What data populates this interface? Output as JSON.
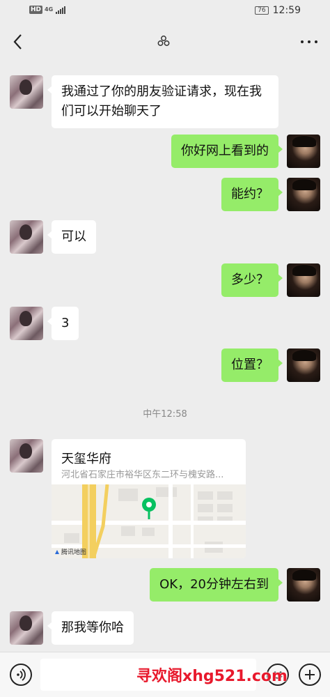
{
  "status_bar": {
    "hd_badge": "HD",
    "network": "4G",
    "battery": "76",
    "time": "12:59"
  },
  "nav": {
    "back_icon": "chevron-left-icon",
    "title_icon": "group-icon",
    "more_icon": "more-dots-icon"
  },
  "messages": [
    {
      "side": "left",
      "text": "我通过了你的朋友验证请求，现在我们可以开始聊天了"
    },
    {
      "side": "right",
      "text": "你好网上看到的"
    },
    {
      "side": "right",
      "text": "能约？"
    },
    {
      "side": "left",
      "text": "可以"
    },
    {
      "side": "right",
      "text": "多少？"
    },
    {
      "side": "left",
      "text": "3"
    },
    {
      "side": "right",
      "text": "位置？"
    },
    {
      "side": "left",
      "type": "location"
    },
    {
      "side": "right",
      "text": "OK，20分钟左右到"
    },
    {
      "side": "left",
      "text": "那我等你哈"
    }
  ],
  "timestamp": "中午12:58",
  "location": {
    "name": "天玺华府",
    "address": "河北省石家庄市裕华区东二环与槐安路...",
    "map_provider": "腾讯地图",
    "pin_color": "#07c160"
  },
  "input_bar": {
    "voice_icon": "voice-icon",
    "emoji_icon": "emoji-icon",
    "plus_icon": "plus-icon",
    "input_value": ""
  },
  "watermark": "寻欢阁xhg521.com",
  "colors": {
    "background": "#ededed",
    "bubble_self": "#95ec69",
    "bubble_other": "#ffffff",
    "watermark": "#e8192c"
  }
}
